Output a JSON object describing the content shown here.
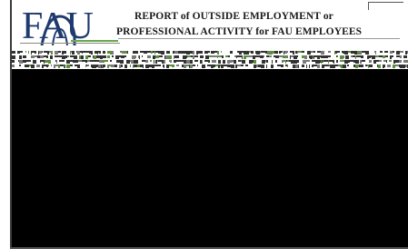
{
  "header": {
    "logo_text": "FAU",
    "title_line1": "REPORT of OUTSIDE EMPLOYMENT or",
    "title_line2": "PROFESSIONAL ACTIVITY for FAU EMPLOYEES"
  },
  "colors": {
    "logo": "#1f3a6e",
    "text": "#1a1a1a",
    "accent_green": "#6aa84f",
    "redacted": "#000000"
  }
}
